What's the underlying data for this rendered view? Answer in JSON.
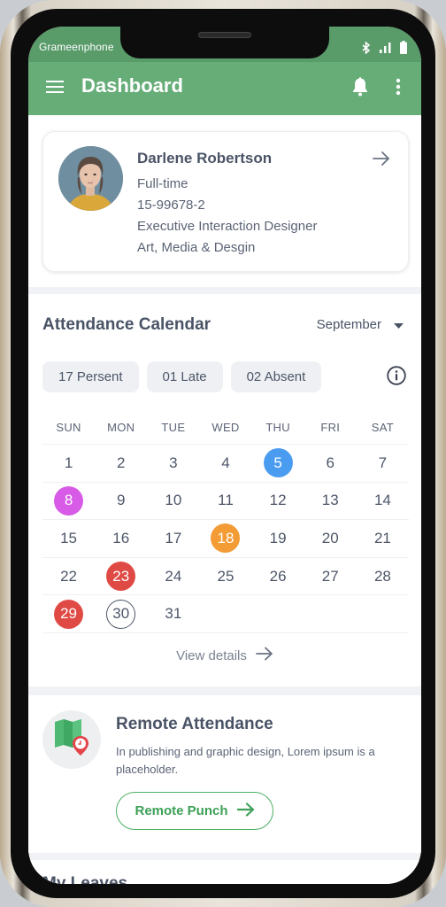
{
  "status_bar": {
    "carrier": "Grameenphone",
    "icons": [
      "bluetooth-icon",
      "signal-icon",
      "battery-icon"
    ]
  },
  "app_bar": {
    "title": "Dashboard",
    "left_icon": "menu-icon",
    "right_icons": [
      "bell-icon",
      "more-vertical-icon"
    ],
    "color": "#66ad78"
  },
  "profile": {
    "name": "Darlene Robertson",
    "employment_type": "Full-time",
    "employee_id": "15-99678-2",
    "designation": "Executive Interaction Designer",
    "department": "Art, Media & Desgin"
  },
  "attendance": {
    "title": "Attendance Calendar",
    "month": "September",
    "chips": [
      {
        "label": "17 Persent"
      },
      {
        "label": "01 Late"
      },
      {
        "label": "02 Absent"
      }
    ],
    "weekdays": [
      "SUN",
      "MON",
      "TUE",
      "WED",
      "THU",
      "FRI",
      "SAT"
    ],
    "weeks": [
      [
        {
          "d": "1"
        },
        {
          "d": "2"
        },
        {
          "d": "3"
        },
        {
          "d": "4"
        },
        {
          "d": "5",
          "status": "filled",
          "color": "#4a9cf0"
        },
        {
          "d": "6"
        },
        {
          "d": "7"
        }
      ],
      [
        {
          "d": "8",
          "status": "filled",
          "color": "#d75be6"
        },
        {
          "d": "9"
        },
        {
          "d": "10"
        },
        {
          "d": "11"
        },
        {
          "d": "12"
        },
        {
          "d": "13"
        },
        {
          "d": "14"
        }
      ],
      [
        {
          "d": "15"
        },
        {
          "d": "16"
        },
        {
          "d": "17"
        },
        {
          "d": "18",
          "status": "filled",
          "color": "#f39b34"
        },
        {
          "d": "19"
        },
        {
          "d": "20"
        },
        {
          "d": "21"
        }
      ],
      [
        {
          "d": "22"
        },
        {
          "d": "23",
          "status": "filled",
          "color": "#e04a45"
        },
        {
          "d": "24"
        },
        {
          "d": "25"
        },
        {
          "d": "26"
        },
        {
          "d": "27"
        },
        {
          "d": "28"
        }
      ],
      [
        {
          "d": "29",
          "status": "filled",
          "color": "#e04a45"
        },
        {
          "d": "30",
          "status": "outlined"
        },
        {
          "d": "31"
        },
        {
          "d": ""
        },
        {
          "d": ""
        },
        {
          "d": ""
        },
        {
          "d": ""
        }
      ]
    ],
    "view_details": "View details"
  },
  "remote_attendance": {
    "title": "Remote Attendance",
    "description": "In publishing and graphic design, Lorem ipsum is a placeholder.",
    "button_label": "Remote Punch",
    "accent": "#4caf63"
  },
  "leaves": {
    "title": "My Leaves"
  }
}
